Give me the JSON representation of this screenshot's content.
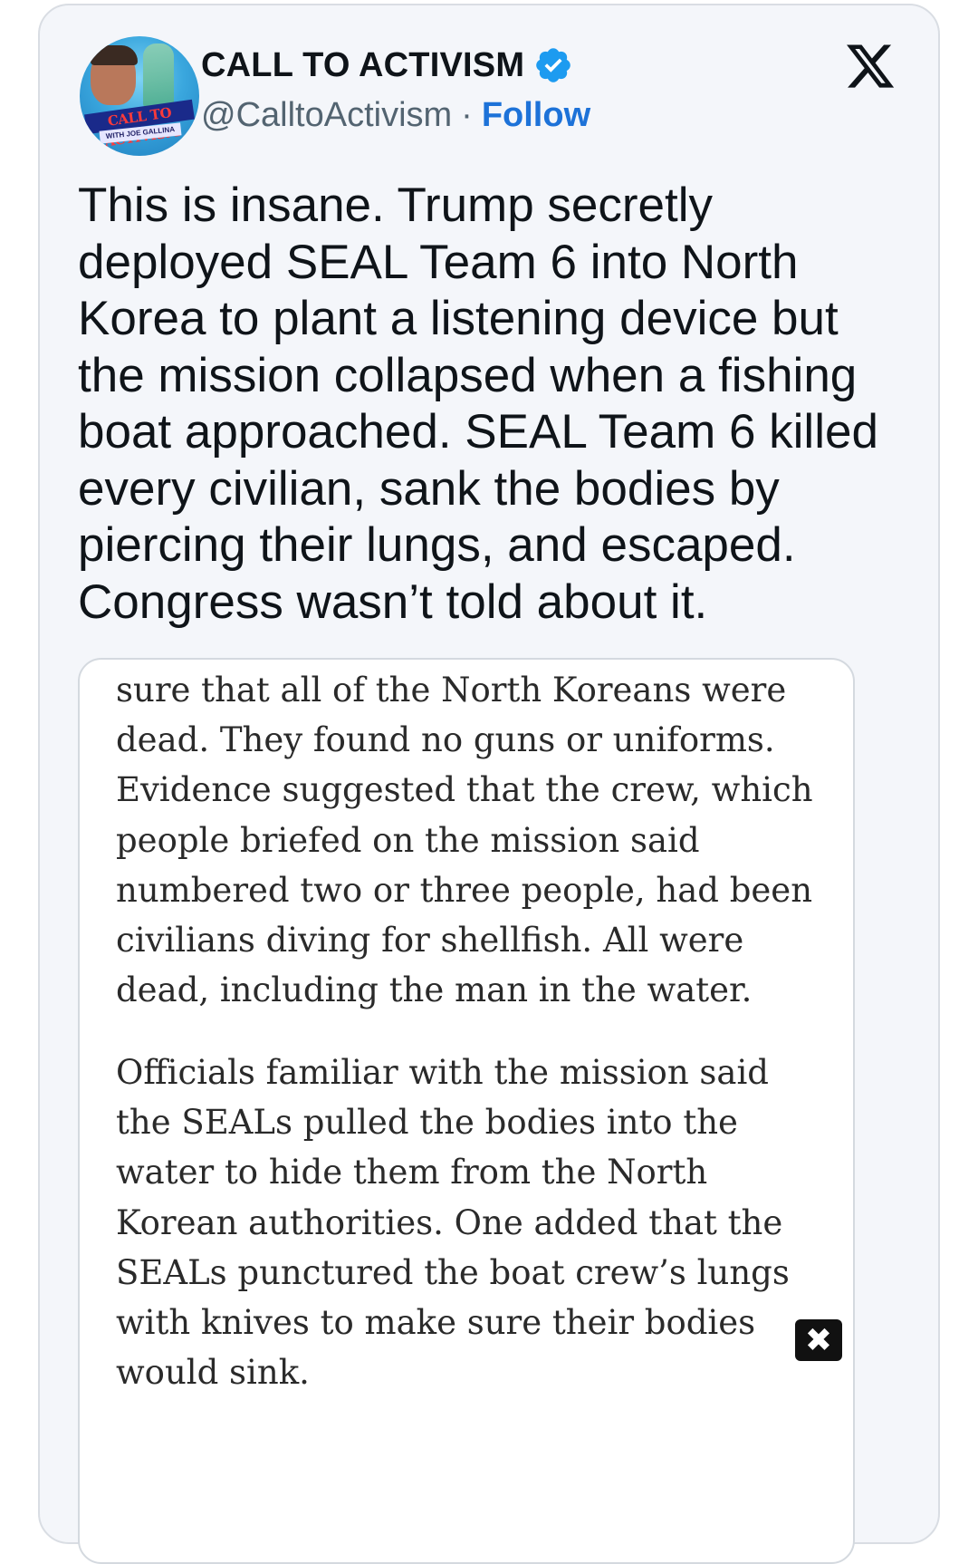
{
  "author": {
    "display_name": "CALL TO ACTIVISM",
    "handle": "@CalltoActivism",
    "separator": "·",
    "follow_label": "Follow",
    "verified_color": "#1d9bf0",
    "avatar_banner": "CALL TO ACTIVISM",
    "avatar_subtext": "WITH JOE GALLINA"
  },
  "brand": {
    "logo": "x-logo-icon"
  },
  "tweet": {
    "text": "This is insane. Trump secretly deployed SEAL Team 6 into North Korea to plant a listening device but the mission collapsed when a fishing boat approached. SEAL Team 6 killed every civilian, sank the bodies by piercing their lungs, and escaped. Congress wasn’t told about it."
  },
  "quoted_image": {
    "paragraph_1": "sure that all of the North Koreans were dead. They found no guns or uniforms. Evidence suggested that the crew, which people briefed on the mission said numbered two or three people, had been civilians diving for shellfish. All were dead, including the man in the water.",
    "paragraph_2": "Officials familiar with the mission said the SEALs pulled the bodies into the water to hide them from the North Korean authorities. One added that the SEALs punctured the boat crew’s lungs with knives to make sure their bodies would sink.",
    "close_glyph": "✖"
  },
  "colors": {
    "card_bg": "#f4f6fa",
    "follow": "#1d72d8",
    "text": "#0f1419",
    "muted": "#536471"
  }
}
